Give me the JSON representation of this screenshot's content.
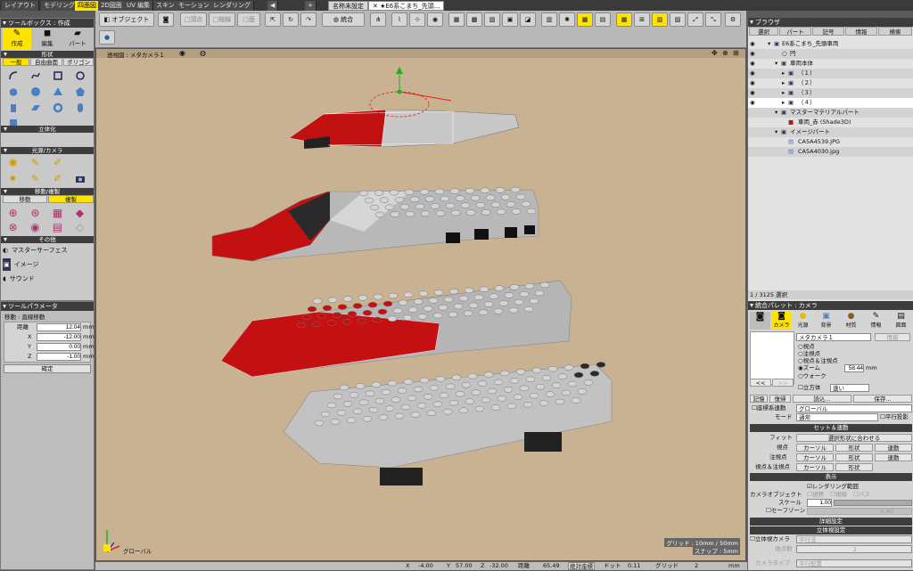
{
  "tabbar": {
    "tabs": [
      "レイアウト",
      "モデリング",
      "四面図",
      "2D図面",
      "UV 編集",
      "スキン",
      "モーション",
      "レンダリング"
    ],
    "active": "四面図",
    "doc_tabs": [
      "名称未設定",
      "E6系こまち_先頭..."
    ],
    "plus": "+"
  },
  "toolbox": {
    "title": "ツールボックス : 作成",
    "modes": [
      "作成",
      "編集",
      "パート"
    ],
    "section_shape": "形状",
    "shape_tabs": [
      "一般",
      "自由曲面",
      "ポリゴン"
    ],
    "section_solid": "立体化",
    "section_light": "光源/カメラ",
    "section_move": "移動/複製",
    "move_tabs": [
      "移動",
      "複製"
    ],
    "section_other": "その他",
    "other_items": [
      "マスターサーフェス",
      "イメージ",
      "サウンド"
    ]
  },
  "toolparam": {
    "title": "ツールパラメータ",
    "subtitle": "移動 : 直線移動",
    "rows": [
      {
        "label": "距離",
        "value": "12.04",
        "unit": "mm"
      },
      {
        "label": "X",
        "value": "-12.00",
        "unit": "mm"
      },
      {
        "label": "Y",
        "value": "0.00",
        "unit": "mm"
      },
      {
        "label": "Z",
        "value": "-1.00",
        "unit": "mm"
      }
    ],
    "confirm": "確定"
  },
  "toolbar": {
    "object_btn": "オブジェクト",
    "point_btn": "頂点",
    "edge_btn": "稜線",
    "face_btn": "面",
    "integrate_btn": "統合"
  },
  "viewport": {
    "title": "透視図 : メタカメラ１",
    "grid_text": "グリッド : 10mm / 50mm",
    "snap_text": "スナップ : 5mm",
    "axis_label": "グローバル",
    "bg_color": "#c9b292"
  },
  "browser": {
    "title": "ブラウザ",
    "tabs": [
      "選択",
      "パート",
      "記号",
      "情報",
      "検索"
    ],
    "tree": [
      {
        "label": "E6系こまち_先頭車両",
        "depth": 0
      },
      {
        "label": "円",
        "depth": 1
      },
      {
        "label": "車両本体",
        "depth": 1
      },
      {
        "label": "（１）",
        "depth": 2
      },
      {
        "label": "（２）",
        "depth": 2
      },
      {
        "label": "（３）",
        "depth": 2
      },
      {
        "label": "（４）",
        "depth": 2
      },
      {
        "label": "マスターマテリアルパート",
        "depth": 1
      },
      {
        "label": "車両_赤 (Shade3D)",
        "depth": 2
      },
      {
        "label": "イメージパート",
        "depth": 1
      },
      {
        "label": "CA5A4539.JPG",
        "depth": 2
      },
      {
        "label": "CA5A4030.jpg",
        "depth": 2
      }
    ],
    "selection_status": "1 / 3125 選択"
  },
  "palette": {
    "title": "統合パレット : カメラ",
    "tabs": [
      "カメラ",
      "光源",
      "背景",
      "材質",
      "情報",
      "図面"
    ],
    "camera_select": "メタカメラ１",
    "info_btn": "情報",
    "radios": [
      "視点",
      "注視点",
      "視点＆注視点",
      "ズーム",
      "ウォーク"
    ],
    "zoom_value": "58.44",
    "zoom_unit": "mm",
    "cube_label": "立方体",
    "speed_value": "速い",
    "prev": "<<",
    "next": ">>",
    "record": "記憶",
    "restore": "復帰",
    "load": "読込...",
    "save": "保存...",
    "link_coord": "座標系連動",
    "link_coord_value": "グローバル",
    "mode_label": "モード",
    "mode_value": "通常",
    "parallel": "平行投影",
    "set_section": "セット＆連動",
    "fit_label": "フィット",
    "fit_btn": "選択形状に合わせる",
    "set_rows": [
      {
        "label": "視点",
        "a": "カーソル",
        "b": "形状",
        "c": "連動"
      },
      {
        "label": "注視点",
        "a": "カーソル",
        "b": "形状",
        "c": "連動"
      },
      {
        "label": "視点＆注視点",
        "a": "カーソル",
        "b": "形状",
        "c": ""
      }
    ],
    "display_section": "表示",
    "render_range": "レンダリング範囲",
    "camera_object": "カメラオブジェクト",
    "cam_opts": [
      "視野",
      "視線",
      "パス"
    ],
    "scale_label": "スケール",
    "scale_value": "1.00",
    "safezone": "セーフゾーン",
    "safezone_value": "0.80",
    "detail_section": "詳細設定",
    "stereo_section": "立体視設定",
    "stereo_camera": "立体視カメラ",
    "stereo_value": "平行法",
    "viewpoints_label": "視点数",
    "viewpoints_value": "2",
    "camera_type_label": "カメラタイプ",
    "camera_type_value": "平行配置"
  },
  "status": {
    "x_label": "X",
    "x": "-4.00",
    "y_label": "Y",
    "y": "57.00",
    "z_label": "Z",
    "z": "-32.00",
    "dist_label": "距離",
    "dist": "65.49",
    "coord_mode": "絶対座標",
    "dot_label": "ドット",
    "dot": "0.11",
    "grid_label": "グリッド",
    "grid": "2",
    "unit": "mm"
  }
}
